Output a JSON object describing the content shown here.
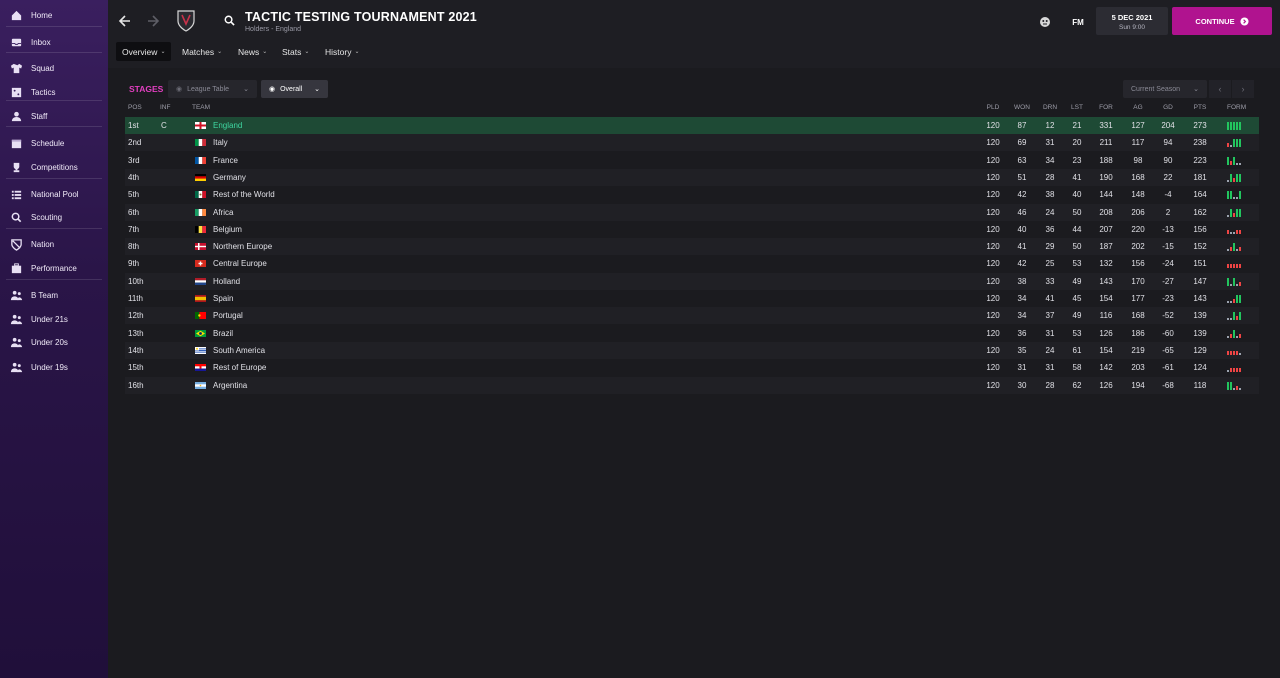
{
  "sidebar": {
    "items": [
      {
        "label": "Home",
        "icon": "home-icon"
      },
      {
        "label": "Inbox",
        "icon": "inbox-icon"
      },
      {
        "label": "Squad",
        "icon": "shirt-icon"
      },
      {
        "label": "Tactics",
        "icon": "tactics-board-icon"
      },
      {
        "label": "Staff",
        "icon": "staff-icon"
      },
      {
        "label": "Schedule",
        "icon": "calendar-icon"
      },
      {
        "label": "Competitions",
        "icon": "trophy-icon"
      },
      {
        "label": "National Pool",
        "icon": "list-icon"
      },
      {
        "label": "Scouting",
        "icon": "search-icon"
      },
      {
        "label": "Nation",
        "icon": "shield-icon"
      },
      {
        "label": "Performance",
        "icon": "briefcase-icon"
      },
      {
        "label": "B Team",
        "icon": "team-icon"
      },
      {
        "label": "Under 21s",
        "icon": "team-icon"
      },
      {
        "label": "Under 20s",
        "icon": "team-icon"
      },
      {
        "label": "Under 19s",
        "icon": "team-icon"
      }
    ]
  },
  "header": {
    "title": "TACTIC TESTING TOURNAMENT 2021",
    "subtitle": "Holders - England",
    "tabs": [
      "Overview",
      "Matches",
      "News",
      "Stats",
      "History"
    ],
    "fm_label": "FM",
    "date_main": "5 DEC 2021",
    "date_sub": "Sun 9:00",
    "continue_label": "CONTINUE"
  },
  "controls": {
    "stages_label": "STAGES",
    "league_table": "League Table",
    "overall": "Overall",
    "season": "Current Season"
  },
  "table": {
    "headers": {
      "pos": "POS",
      "inf": "INF",
      "team": "TEAM",
      "pld": "PLD",
      "won": "WON",
      "drn": "DRN",
      "lst": "LST",
      "for": "FOR",
      "ag": "AG",
      "gd": "GD",
      "pts": "PTS",
      "form": "FORM"
    },
    "rows": [
      {
        "pos": "1st",
        "inf": "C",
        "team": "England",
        "flag": "england",
        "pld": "120",
        "won": "87",
        "drn": "12",
        "lst": "21",
        "for": "331",
        "ag": "127",
        "gd": "204",
        "pts": "273",
        "form": "WWWWW"
      },
      {
        "pos": "2nd",
        "inf": "",
        "team": "Italy",
        "flag": "italy",
        "pld": "120",
        "won": "69",
        "drn": "31",
        "lst": "20",
        "for": "211",
        "ag": "117",
        "gd": "94",
        "pts": "238",
        "form": "LDWWW"
      },
      {
        "pos": "3rd",
        "inf": "",
        "team": "France",
        "flag": "france",
        "pld": "120",
        "won": "63",
        "drn": "34",
        "lst": "23",
        "for": "188",
        "ag": "98",
        "gd": "90",
        "pts": "223",
        "form": "WLWDD"
      },
      {
        "pos": "4th",
        "inf": "",
        "team": "Germany",
        "flag": "germany",
        "pld": "120",
        "won": "51",
        "drn": "28",
        "lst": "41",
        "for": "190",
        "ag": "168",
        "gd": "22",
        "pts": "181",
        "form": "DWLWW"
      },
      {
        "pos": "5th",
        "inf": "",
        "team": "Rest of the World",
        "flag": "mexico",
        "pld": "120",
        "won": "42",
        "drn": "38",
        "lst": "40",
        "for": "144",
        "ag": "148",
        "gd": "-4",
        "pts": "164",
        "form": "WWDDW"
      },
      {
        "pos": "6th",
        "inf": "",
        "team": "Africa",
        "flag": "ireland",
        "pld": "120",
        "won": "46",
        "drn": "24",
        "lst": "50",
        "for": "208",
        "ag": "206",
        "gd": "2",
        "pts": "162",
        "form": "DWLWW"
      },
      {
        "pos": "7th",
        "inf": "",
        "team": "Belgium",
        "flag": "belgium",
        "pld": "120",
        "won": "40",
        "drn": "36",
        "lst": "44",
        "for": "207",
        "ag": "220",
        "gd": "-13",
        "pts": "156",
        "form": "LDDLL"
      },
      {
        "pos": "8th",
        "inf": "",
        "team": "Northern Europe",
        "flag": "denmark",
        "pld": "120",
        "won": "41",
        "drn": "29",
        "lst": "50",
        "for": "187",
        "ag": "202",
        "gd": "-15",
        "pts": "152",
        "form": "DLWDL"
      },
      {
        "pos": "9th",
        "inf": "",
        "team": "Central Europe",
        "flag": "switzerland",
        "pld": "120",
        "won": "42",
        "drn": "25",
        "lst": "53",
        "for": "132",
        "ag": "156",
        "gd": "-24",
        "pts": "151",
        "form": "LLLLL"
      },
      {
        "pos": "10th",
        "inf": "",
        "team": "Holland",
        "flag": "holland",
        "pld": "120",
        "won": "38",
        "drn": "33",
        "lst": "49",
        "for": "143",
        "ag": "170",
        "gd": "-27",
        "pts": "147",
        "form": "WDWDL"
      },
      {
        "pos": "11th",
        "inf": "",
        "team": "Spain",
        "flag": "spain",
        "pld": "120",
        "won": "34",
        "drn": "41",
        "lst": "45",
        "for": "154",
        "ag": "177",
        "gd": "-23",
        "pts": "143",
        "form": "DDLWW"
      },
      {
        "pos": "12th",
        "inf": "",
        "team": "Portugal",
        "flag": "portugal",
        "pld": "120",
        "won": "34",
        "drn": "37",
        "lst": "49",
        "for": "116",
        "ag": "168",
        "gd": "-52",
        "pts": "139",
        "form": "DDWLW"
      },
      {
        "pos": "13th",
        "inf": "",
        "team": "Brazil",
        "flag": "brazil",
        "pld": "120",
        "won": "36",
        "drn": "31",
        "lst": "53",
        "for": "126",
        "ag": "186",
        "gd": "-60",
        "pts": "139",
        "form": "DLWDL"
      },
      {
        "pos": "14th",
        "inf": "",
        "team": "South America",
        "flag": "uruguay",
        "pld": "120",
        "won": "35",
        "drn": "24",
        "lst": "61",
        "for": "154",
        "ag": "219",
        "gd": "-65",
        "pts": "129",
        "form": "LLLLD"
      },
      {
        "pos": "15th",
        "inf": "",
        "team": "Rest of Europe",
        "flag": "croatia",
        "pld": "120",
        "won": "31",
        "drn": "31",
        "lst": "58",
        "for": "142",
        "ag": "203",
        "gd": "-61",
        "pts": "124",
        "form": "DLLLL"
      },
      {
        "pos": "16th",
        "inf": "",
        "team": "Argentina",
        "flag": "argentina",
        "pld": "120",
        "won": "30",
        "drn": "28",
        "lst": "62",
        "for": "126",
        "ag": "194",
        "gd": "-68",
        "pts": "118",
        "form": "WWDLD"
      }
    ]
  },
  "colors": {
    "accent": "#b0138f",
    "stages": "#e23fc0",
    "leader_row": "#1e4a35",
    "leader_text": "#3ed6a0",
    "form_win": "#22c55e",
    "form_loss": "#ef4444",
    "form_draw": "#9ca3af"
  }
}
